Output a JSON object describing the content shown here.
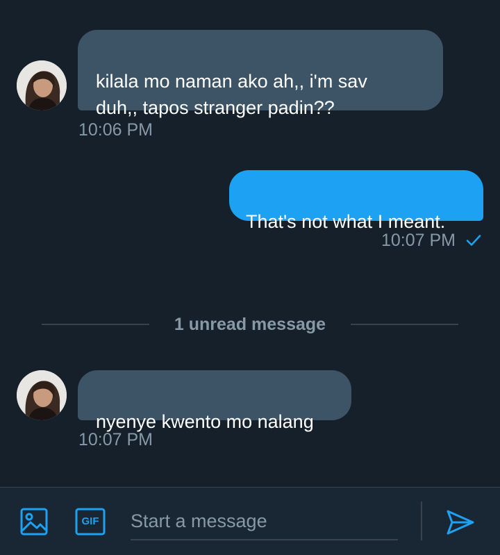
{
  "colors": {
    "background": "#15202b",
    "incoming_bubble": "#3d5466",
    "outgoing_bubble": "#1da1f2",
    "secondary_text": "#8899a6",
    "accent": "#1da1f2"
  },
  "messages": [
    {
      "direction": "incoming",
      "text": "kilala mo naman ako ah,, i'm sav\nduh,, tapos stranger padin??",
      "time": "10:06 PM",
      "avatar_icon": "user-avatar"
    },
    {
      "direction": "outgoing",
      "text": "That's not what I meant.",
      "time": "10:07 PM",
      "status_icon": "checkmark-icon"
    },
    {
      "direction": "incoming",
      "text": "nyenye kwento mo nalang",
      "time": "10:07 PM",
      "avatar_icon": "user-avatar"
    }
  ],
  "unread_divider": "1 unread message",
  "composer": {
    "placeholder": "Start a message",
    "image_icon": "image-icon",
    "gif_icon": "gif-icon",
    "gif_label": "GIF",
    "send_icon": "send-icon"
  }
}
